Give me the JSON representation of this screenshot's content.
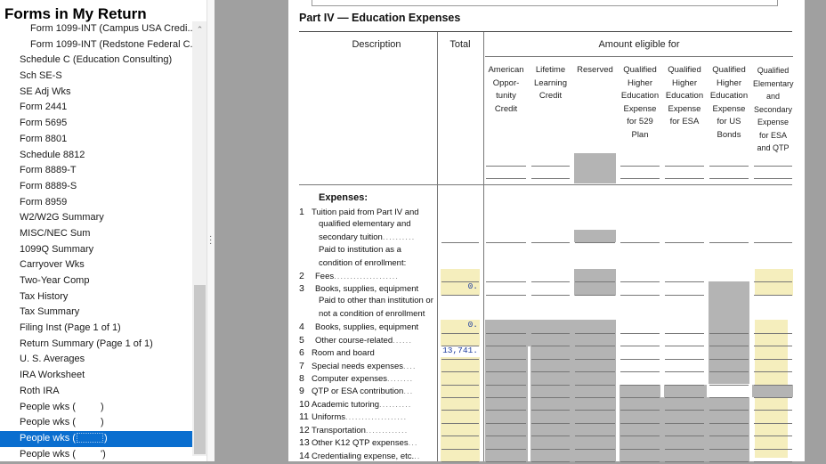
{
  "sidebar": {
    "title": "Forms in My Return",
    "items": [
      {
        "label": "Form 1099-INT (Campus USA Credi...",
        "sub": true
      },
      {
        "label": "Form 1099-INT (Redstone Federal C...",
        "sub": true
      },
      {
        "label": "Schedule C (Education Consulting)"
      },
      {
        "label": "Sch SE-S"
      },
      {
        "label": "SE Adj Wks"
      },
      {
        "label": "Form 2441"
      },
      {
        "label": "Form 5695"
      },
      {
        "label": "Form 8801"
      },
      {
        "label": "Schedule 8812"
      },
      {
        "label": "Form 8889-T"
      },
      {
        "label": "Form 8889-S"
      },
      {
        "label": "Form 8959"
      },
      {
        "label": "W2/W2G Summary"
      },
      {
        "label": "MISC/NEC Sum"
      },
      {
        "label": "1099Q Summary"
      },
      {
        "label": "Carryover Wks"
      },
      {
        "label": "Two-Year Comp"
      },
      {
        "label": "Tax History"
      },
      {
        "label": "Tax Summary"
      },
      {
        "label": "Filing Inst (Page 1 of 1)"
      },
      {
        "label": "Return Summary (Page 1 of 1)"
      },
      {
        "label": "U. S. Averages"
      },
      {
        "label": "IRA Worksheet"
      },
      {
        "label": "Roth IRA"
      },
      {
        "label": "People wks (",
        "suffix": ")",
        "redacted": true
      },
      {
        "label": "People wks (",
        "suffix": ")",
        "redacted": true
      },
      {
        "label": "People wks (",
        "suffix": ")",
        "redacted": true,
        "selected": true
      },
      {
        "label": "People wks (",
        "suffix": "')",
        "redacted": true
      }
    ]
  },
  "form": {
    "part_title": "Part IV — Education Expenses",
    "header_description": "Description",
    "header_total": "Total",
    "header_amount": "Amount eligible for",
    "columns": [
      "American Oppor- tunity Credit",
      "Lifetime Learning Credit",
      "Reserved",
      "Qualified Higher Education Expense for 529 Plan",
      "Qualified Higher Education Expense for ESA",
      "Qualified Higher Education Expense for US Bonds",
      "Qualified Elementary and Secondary Expense for ESA and QTP"
    ],
    "expenses_heading": "Expenses:",
    "line1": [
      "Tuition paid from Part IV and",
      "qualified elementary and",
      "secondary tuition",
      "Paid to institution as a",
      "condition of enrollment:"
    ],
    "line2": "Fees",
    "line3": "Books, supplies, equipment",
    "line3_amount": "0.",
    "paid_other": [
      "Paid to other than institution or",
      "not a condition of enrollment"
    ],
    "line4": "Books, supplies, equipment",
    "line4_amount": "0.",
    "line5": "Other course-related",
    "line6": "Room and board",
    "line6_amount": "13,741.",
    "line7": "Special needs expenses",
    "line8": "Computer expenses",
    "line9": "QTP or ESA contribution",
    "line10": "Academic tutoring",
    "line11": "Uniforms",
    "line12": "Transportation",
    "line13": "Other K12 QTP expenses",
    "line14": "Credentialing expense, etc."
  },
  "colors": {
    "selected": "#0a6ecf",
    "yellow_cell": "#f5eebd",
    "gray_cell": "#b4b4b4",
    "amount_text": "#1a3a9c"
  },
  "icons": [
    "scroll-up-icon",
    "splitter-grip-icon"
  ]
}
